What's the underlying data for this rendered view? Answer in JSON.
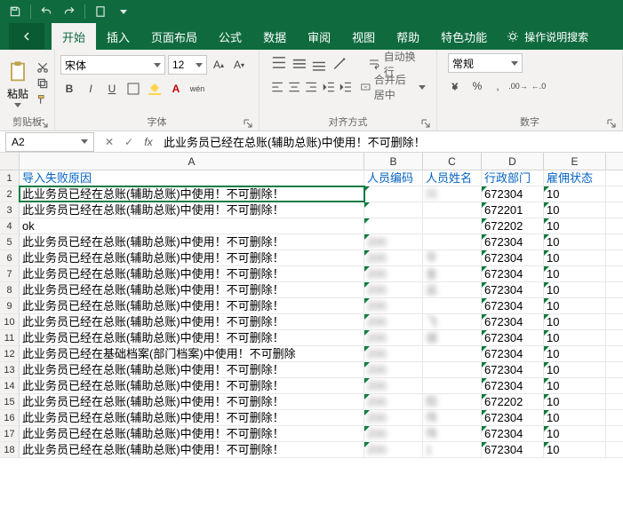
{
  "qat": {
    "save": "save-icon",
    "undo": "undo-icon",
    "redo": "redo-icon",
    "new": "new-icon"
  },
  "ribbonTabs": [
    "开始",
    "插入",
    "页面布局",
    "公式",
    "数据",
    "审阅",
    "视图",
    "帮助",
    "特色功能"
  ],
  "activeTab": "开始",
  "tellMe": "操作说明搜索",
  "clipboard": {
    "paste": "粘贴",
    "label": "剪贴板"
  },
  "font": {
    "name": "宋体",
    "size": "12",
    "label": "字体"
  },
  "align": {
    "wrap": "自动换行",
    "merge": "合并后居中",
    "label": "对齐方式"
  },
  "number": {
    "format": "常规",
    "label": "数字"
  },
  "formulaBar": {
    "nameBox": "A2",
    "formula": "此业务员已经在总账(辅助总账)中使用！不可删除！"
  },
  "columns": [
    "A",
    "B",
    "C",
    "D",
    "E"
  ],
  "headerRow": {
    "A": "导入失败原因",
    "B": "人员编码",
    "C": "人员姓名",
    "D": "行政部门",
    "E": "雇佣状态"
  },
  "rows": [
    {
      "n": 2,
      "A": "此业务员已经在总账(辅助总账)中使用！不可删除！",
      "B": "",
      "C": "兴",
      "D": "672304",
      "E": "10",
      "sel": true
    },
    {
      "n": 3,
      "A": "此业务员已经在总账(辅助总账)中使用！不可删除！",
      "B": "",
      "C": "",
      "D": "672201",
      "E": "10"
    },
    {
      "n": 4,
      "A": "ok",
      "B": "",
      "C": "",
      "D": "672202",
      "E": "10"
    },
    {
      "n": 5,
      "A": "此业务员已经在总账(辅助总账)中使用！不可删除！",
      "B": "200",
      "C": "",
      "D": "672304",
      "E": "10"
    },
    {
      "n": 6,
      "A": "此业务员已经在总账(辅助总账)中使用！不可删除！",
      "B": "200",
      "C": "平",
      "D": "672304",
      "E": "10"
    },
    {
      "n": 7,
      "A": "此业务员已经在总账(辅助总账)中使用！不可删除！",
      "B": "200",
      "C": "金",
      "D": "672304",
      "E": "10"
    },
    {
      "n": 8,
      "A": "此业务员已经在总账(辅助总账)中使用！不可删除！",
      "B": "200",
      "C": "运",
      "D": "672304",
      "E": "10"
    },
    {
      "n": 9,
      "A": "此业务员已经在总账(辅助总账)中使用！不可删除！",
      "B": "200",
      "C": "",
      "D": "672304",
      "E": "10"
    },
    {
      "n": 10,
      "A": "此业务员已经在总账(辅助总账)中使用！不可删除！",
      "B": "200",
      "C": "飞",
      "D": "672304",
      "E": "10"
    },
    {
      "n": 11,
      "A": "此业务员已经在总账(辅助总账)中使用！不可删除！",
      "B": "200",
      "C": "诚",
      "D": "672304",
      "E": "10"
    },
    {
      "n": 12,
      "A": "此业务员已经在基础档案(部门档案)中使用！不可删除",
      "B": "200",
      "C": "",
      "D": "672304",
      "E": "10"
    },
    {
      "n": 13,
      "A": "此业务员已经在总账(辅助总账)中使用！不可删除！",
      "B": "200",
      "C": "",
      "D": "672304",
      "E": "10"
    },
    {
      "n": 14,
      "A": "此业务员已经在总账(辅助总账)中使用！不可删除！",
      "B": "200",
      "C": "",
      "D": "672304",
      "E": "10"
    },
    {
      "n": 15,
      "A": "此业务员已经在总账(辅助总账)中使用！不可删除！",
      "B": "200",
      "C": "阳",
      "D": "672202",
      "E": "10"
    },
    {
      "n": 16,
      "A": "此业务员已经在总账(辅助总账)中使用！不可删除！",
      "B": "200",
      "C": "伟",
      "D": "672304",
      "E": "10"
    },
    {
      "n": 17,
      "A": "此业务员已经在总账(辅助总账)中使用！不可删除！",
      "B": "200",
      "C": "伟",
      "D": "672304",
      "E": "10"
    },
    {
      "n": 18,
      "A": "此业务员已经在总账(辅助总账)中使用！不可删除！",
      "B": "200",
      "C": "1",
      "D": "672304",
      "E": "10"
    }
  ]
}
